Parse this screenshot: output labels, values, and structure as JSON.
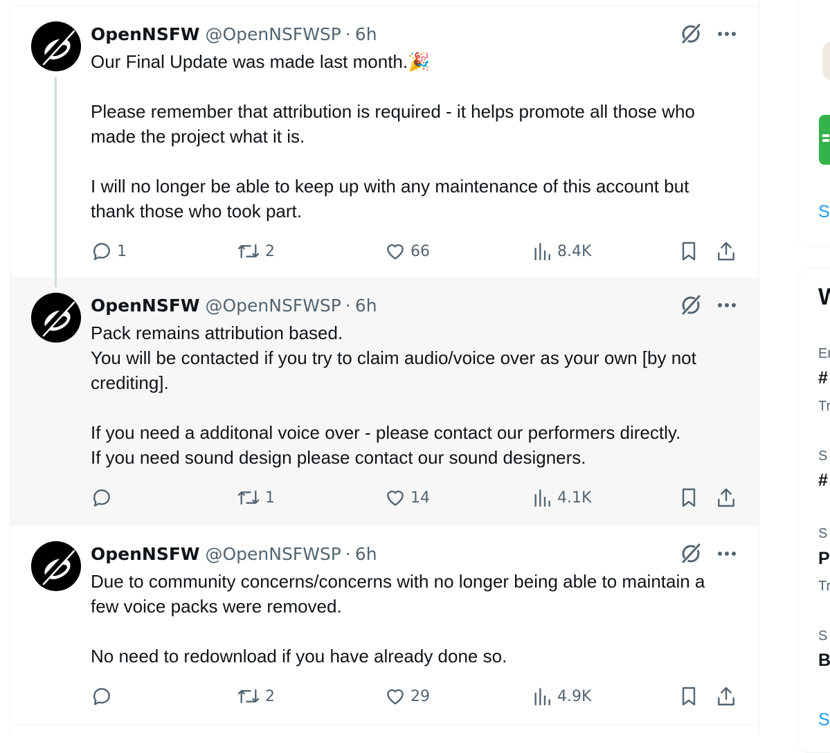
{
  "tweets": [
    {
      "name": "OpenNSFW",
      "handle": "@OpenNSFWSP",
      "time": "6h",
      "text": "Our Final Update was made last month.🎉\n\nPlease remember that attribution is required - it helps promote all those who made the project what it is.\n\nI will no longer be able to keep up with any maintenance of this account but thank those who took part.",
      "replies": "1",
      "reposts": "2",
      "likes": "66",
      "views": "8.4K"
    },
    {
      "name": "OpenNSFW",
      "handle": "@OpenNSFWSP",
      "time": "6h",
      "text": "Pack remains attribution based.\nYou will be contacted if you try to claim audio/voice over as your own [by not crediting].\n\nIf you need a additonal voice over - please contact our performers directly.\nIf you need sound design please contact our sound designers.",
      "replies": "",
      "reposts": "1",
      "likes": "14",
      "views": "4.1K"
    },
    {
      "name": "OpenNSFW",
      "handle": "@OpenNSFWSP",
      "time": "6h",
      "text": "Due to community concerns/concerns with no longer being able to maintain a few voice packs were removed.\n\nNo need to redownload if you have already done so.",
      "replies": "",
      "reposts": "2",
      "likes": "29",
      "views": "4.9K"
    }
  ],
  "separator": "·",
  "sidebar": {
    "link1": "S",
    "heading": "W",
    "items": [
      {
        "meta": "Er",
        "title": "#",
        "sub": "Tr"
      },
      {
        "meta": "S",
        "title": "#",
        "sub": ""
      },
      {
        "meta": "S",
        "title": "P",
        "sub": "Tr"
      },
      {
        "meta": "S",
        "title": "B",
        "sub": ""
      }
    ],
    "link2": "S"
  },
  "colors": {
    "text": "#0f1419",
    "secondary": "#536471",
    "link": "#1d9bf0",
    "highlight_bg": "#f7f7f7",
    "border": "#eff3f4"
  }
}
